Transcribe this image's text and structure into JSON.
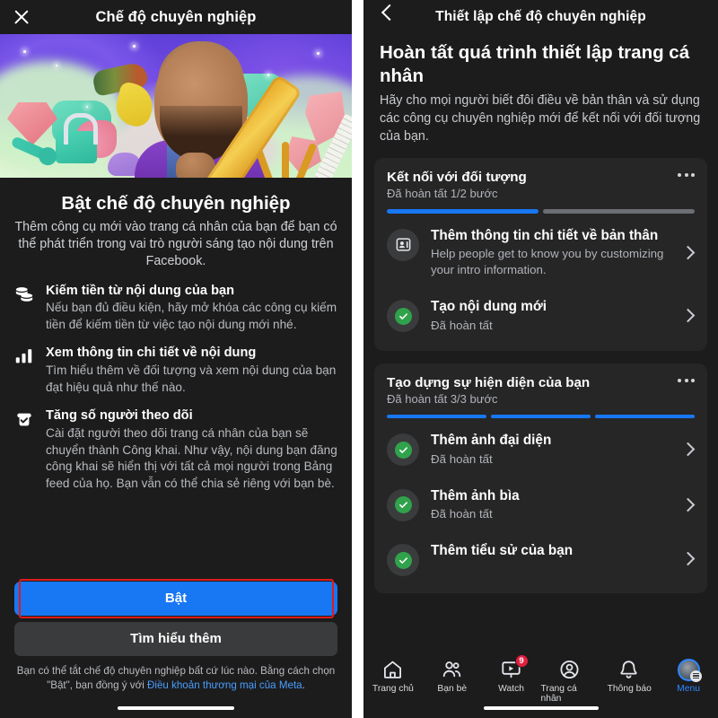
{
  "left": {
    "topbar": {
      "close_icon": "close-icon",
      "title": "Chế độ chuyên nghiệp"
    },
    "hero_alt": "professional-mode-illustration",
    "heading": "Bật chế độ chuyên nghiệp",
    "subheading": "Thêm công cụ mới vào trang cá nhân của bạn để bạn có thể phát triển trong vai trò người sáng tạo nội dung trên Facebook.",
    "features": [
      {
        "icon": "coins-icon",
        "title": "Kiếm tiền từ nội dung của bạn",
        "desc": "Nếu bạn đủ điều kiện, hãy mở khóa các công cụ kiếm tiền để kiếm tiền từ việc tạo nội dung mới nhé."
      },
      {
        "icon": "bar-chart-icon",
        "title": "Xem thông tin chi tiết về nội dung",
        "desc": "Tìm hiểu thêm về đối tượng và xem nội dung của bạn đạt hiệu quả như thế nào."
      },
      {
        "icon": "follow-check-icon",
        "title": "Tăng số người theo dõi",
        "desc": "Cài đặt người theo dõi trang cá nhân của bạn sẽ chuyển thành Công khai. Như vậy, nội dung bạn đăng công khai sẽ hiển thị với tất cả mọi người trong Bảng feed của họ. Bạn vẫn có thể chia sẻ riêng với bạn bè."
      }
    ],
    "primary_button": "Bật",
    "secondary_button": "Tìm hiểu thêm",
    "legal_text_before": "Bạn có thể tắt chế độ chuyên nghiệp bất cứ lúc nào. Bằng cách chọn \"Bật\", bạn đồng ý với ",
    "legal_link": "Điều khoản thương mại của Meta",
    "legal_text_after": ".",
    "highlight_color": "#e01b1b",
    "primary_color": "#1877f2"
  },
  "right": {
    "topbar": {
      "back_icon": "chevron-left-icon",
      "title": "Thiết lập chế độ chuyên nghiệp"
    },
    "heading": "Hoàn tất quá trình thiết lập trang cá nhân",
    "subheading": "Hãy cho mọi người biết đôi điều về bản thân và sử dụng các công cụ chuyên nghiệp mới để kết nối với đối tượng của bạn.",
    "cards": [
      {
        "title": "Kết nối với đối tượng",
        "meta": "Đã hoàn tất 1/2 bước",
        "steps_total": 2,
        "steps_done": 1,
        "more_icon": "more-horizontal-icon",
        "rows": [
          {
            "icon": "profile-details-icon",
            "completed": false,
            "title": "Thêm thông tin chi tiết về bản thân",
            "subtitle": "Help people get to know you by customizing your intro information.",
            "chevron": "chevron-right-icon"
          },
          {
            "icon": "check-circle-icon",
            "completed": true,
            "title": "Tạo nội dung mới",
            "subtitle": "Đã hoàn tất",
            "chevron": "chevron-right-icon"
          }
        ]
      },
      {
        "title": "Tạo dựng sự hiện diện của bạn",
        "meta": "Đã hoàn tất 3/3 bước",
        "steps_total": 3,
        "steps_done": 3,
        "more_icon": "more-horizontal-icon",
        "rows": [
          {
            "icon": "check-circle-icon",
            "completed": true,
            "title": "Thêm ảnh đại diện",
            "subtitle": "Đã hoàn tất",
            "chevron": "chevron-right-icon"
          },
          {
            "icon": "check-circle-icon",
            "completed": true,
            "title": "Thêm ảnh bìa",
            "subtitle": "Đã hoàn tất",
            "chevron": "chevron-right-icon"
          },
          {
            "icon": "check-circle-icon",
            "completed": true,
            "title": "Thêm tiểu sử của bạn",
            "subtitle": "",
            "chevron": "chevron-right-icon"
          }
        ]
      }
    ],
    "bottom_nav": [
      {
        "icon": "home-icon",
        "label": "Trang chủ",
        "active": false,
        "badge": ""
      },
      {
        "icon": "friends-icon",
        "label": "Bạn bè",
        "active": false,
        "badge": ""
      },
      {
        "icon": "watch-icon",
        "label": "Watch",
        "active": false,
        "badge": "9"
      },
      {
        "icon": "profile-icon",
        "label": "Trang cá nhân",
        "active": false,
        "badge": ""
      },
      {
        "icon": "bell-icon",
        "label": "Thông báo",
        "active": false,
        "badge": ""
      },
      {
        "icon": "menu-avatar-icon",
        "label": "Menu",
        "active": true,
        "badge": ""
      }
    ],
    "accent_color": "#1877f2",
    "done_color": "#31a24c",
    "badge_color": "#e41e3f"
  }
}
